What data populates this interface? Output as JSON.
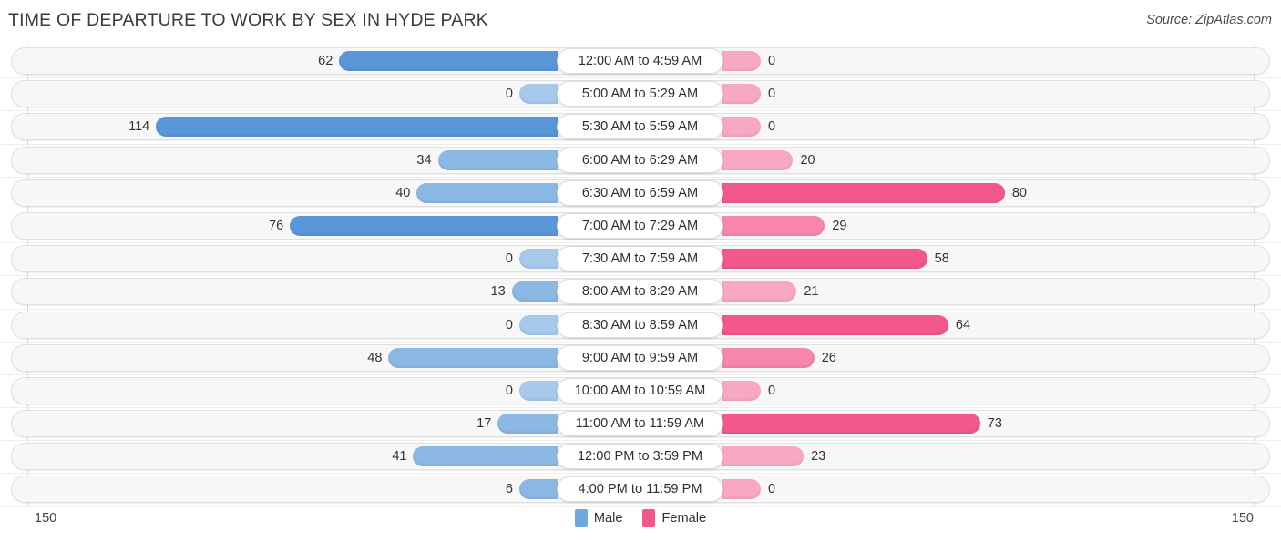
{
  "header": {
    "title": "TIME OF DEPARTURE TO WORK BY SEX IN HYDE PARK",
    "source": "Source: ZipAtlas.com"
  },
  "axis": {
    "left_max": "150",
    "right_max": "150"
  },
  "legend": {
    "items": [
      {
        "label": "Male",
        "color": "#6fa8dc"
      },
      {
        "label": "Female",
        "color": "#f2588c"
      }
    ]
  },
  "colors": {
    "male_light": "#a7c9ec",
    "male_mid": "#8cb8e4",
    "male_dark": "#5b96d9",
    "female_light": "#f9a8c4",
    "female_mid": "#f786ac",
    "female_dark": "#f2588c",
    "track": "#f7f7f7",
    "gridline": "#d8d8d8"
  },
  "chart_data": {
    "type": "bar",
    "subtype": "diverging-horizontal",
    "title": "TIME OF DEPARTURE TO WORK BY SEX IN HYDE PARK",
    "xlabel": "",
    "ylabel": "",
    "xlim": [
      150,
      150
    ],
    "grid": true,
    "legend_position": "bottom-center",
    "categories": [
      "12:00 AM to 4:59 AM",
      "5:00 AM to 5:29 AM",
      "5:30 AM to 5:59 AM",
      "6:00 AM to 6:29 AM",
      "6:30 AM to 6:59 AM",
      "7:00 AM to 7:29 AM",
      "7:30 AM to 7:59 AM",
      "8:00 AM to 8:29 AM",
      "8:30 AM to 8:59 AM",
      "9:00 AM to 9:59 AM",
      "10:00 AM to 10:59 AM",
      "11:00 AM to 11:59 AM",
      "12:00 PM to 3:59 PM",
      "4:00 PM to 11:59 PM"
    ],
    "series": [
      {
        "name": "Male",
        "side": "left",
        "values": [
          62,
          0,
          114,
          34,
          40,
          76,
          0,
          13,
          0,
          48,
          0,
          17,
          41,
          6
        ]
      },
      {
        "name": "Female",
        "side": "right",
        "values": [
          0,
          0,
          0,
          20,
          80,
          29,
          58,
          21,
          64,
          26,
          0,
          73,
          23,
          0
        ]
      }
    ]
  },
  "rows": [
    {
      "category": "12:00 AM to 4:59 AM",
      "male": "62",
      "female": "0"
    },
    {
      "category": "5:00 AM to 5:29 AM",
      "male": "0",
      "female": "0"
    },
    {
      "category": "5:30 AM to 5:59 AM",
      "male": "114",
      "female": "0"
    },
    {
      "category": "6:00 AM to 6:29 AM",
      "male": "34",
      "female": "20"
    },
    {
      "category": "6:30 AM to 6:59 AM",
      "male": "40",
      "female": "80"
    },
    {
      "category": "7:00 AM to 7:29 AM",
      "male": "76",
      "female": "29"
    },
    {
      "category": "7:30 AM to 7:59 AM",
      "male": "0",
      "female": "58"
    },
    {
      "category": "8:00 AM to 8:29 AM",
      "male": "13",
      "female": "21"
    },
    {
      "category": "8:30 AM to 8:59 AM",
      "male": "0",
      "female": "64"
    },
    {
      "category": "9:00 AM to 9:59 AM",
      "male": "48",
      "female": "26"
    },
    {
      "category": "10:00 AM to 10:59 AM",
      "male": "0",
      "female": "0"
    },
    {
      "category": "11:00 AM to 11:59 AM",
      "male": "17",
      "female": "73"
    },
    {
      "category": "12:00 PM to 3:59 PM",
      "male": "41",
      "female": "23"
    },
    {
      "category": "4:00 PM to 11:59 PM",
      "male": "6",
      "female": "0"
    }
  ]
}
